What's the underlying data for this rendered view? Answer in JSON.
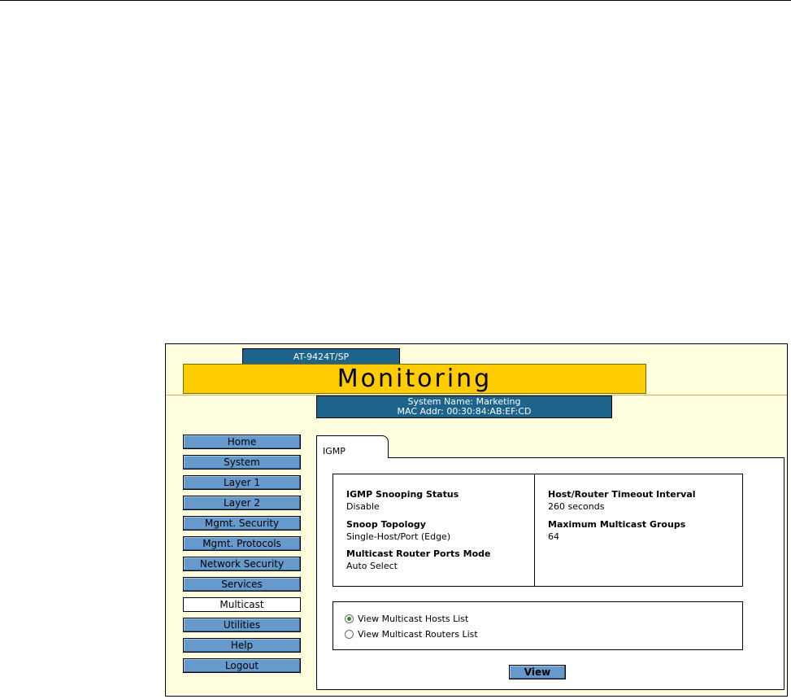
{
  "header": {
    "model": "AT-9424T/SP",
    "title": "Monitoring",
    "system_name": "System Name: Marketing",
    "mac_addr": "MAC Addr: 00:30:84:AB:EF:CD"
  },
  "nav": {
    "items": [
      {
        "label": "Home"
      },
      {
        "label": "System"
      },
      {
        "label": "Layer 1"
      },
      {
        "label": "Layer 2"
      },
      {
        "label": "Mgmt. Security"
      },
      {
        "label": "Mgmt. Protocols"
      },
      {
        "label": "Network Security"
      },
      {
        "label": "Services"
      },
      {
        "label": "Multicast",
        "active": true
      },
      {
        "label": "Utilities"
      },
      {
        "label": "Help"
      },
      {
        "label": "Logout"
      }
    ]
  },
  "tab": {
    "label": "IGMP"
  },
  "info": {
    "snooping_status_label": "IGMP Snooping Status",
    "snooping_status_value": "Disable",
    "snoop_topology_label": "Snoop Topology",
    "snoop_topology_value": "Single-Host/Port (Edge)",
    "router_ports_mode_label": "Multicast Router Ports Mode",
    "router_ports_mode_value": "Auto Select",
    "timeout_label": "Host/Router Timeout Interval",
    "timeout_value": "260 seconds",
    "max_groups_label": "Maximum Multicast Groups",
    "max_groups_value": "64"
  },
  "options": {
    "hosts_label": "View Multicast Hosts List",
    "routers_label": "View Multicast Routers List",
    "selected": "hosts"
  },
  "actions": {
    "view_label": "View"
  },
  "colors": {
    "accent_blue": "#1d648c",
    "banner_yellow": "#ffcc00",
    "button_blue": "#6699cc",
    "frame_bg": "#ffffe0"
  }
}
